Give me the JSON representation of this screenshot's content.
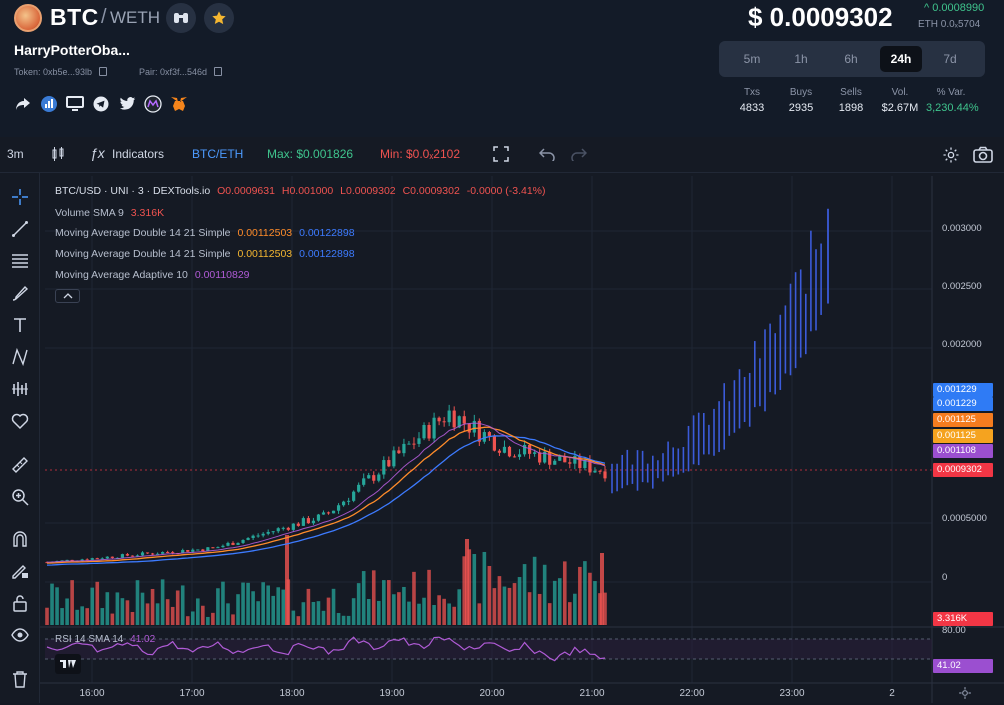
{
  "header": {
    "pair": "BTC",
    "separator": "/",
    "quote": "WETH",
    "token_name": "HarryPotterOba...",
    "token_addr": "Token: 0xb5e...93lb",
    "pair_addr": "Pair: 0xf3f...546d",
    "price": "$ 0.0009302",
    "change": "^ 0.0008990",
    "eth_price": "ETH 0.0ₓ5704",
    "timeframes": [
      "5m",
      "1h",
      "6h",
      "24h",
      "7d"
    ],
    "active_timeframe": "24h",
    "stats": [
      {
        "label": "Txs",
        "value": "4833"
      },
      {
        "label": "Buys",
        "value": "2935"
      },
      {
        "label": "Sells",
        "value": "1898"
      },
      {
        "label": "Vol.",
        "value": "$2.67M"
      },
      {
        "label": "% Var.",
        "value": "3,230.44%"
      }
    ]
  },
  "toolbar": {
    "interval": "3m",
    "indicators": "Indicators",
    "symbol": "BTC/ETH",
    "max": "Max: $0.001826",
    "min": "Min: $0.0ₓ2102"
  },
  "legend": {
    "title": "BTC/USD · UNI · 3 · DEXTools.io",
    "o": "O0.0009631",
    "h": "H0.001000",
    "l": "L0.0009302",
    "c": "C0.0009302",
    "chg": "-0.0000 (-3.41%)",
    "volume_label": "Volume SMA 9",
    "volume_value": "3.316K",
    "ma1_label": "Moving Average Double 14 21 Simple",
    "ma1_v1": "0.00112503",
    "ma1_v2": "0.00122898",
    "ma2_label": "Moving Average Double 14 21 Simple",
    "ma2_v1": "0.00112503",
    "ma2_v2": "0.00122898",
    "ma3_label": "Moving Average Adaptive 10",
    "ma3_v1": "0.00110829",
    "rsi_label": "RSI 14 SMA 14",
    "rsi_value": "41.02"
  },
  "yaxis": {
    "ticks": [
      "0.003000",
      "0.002500",
      "0.002000",
      "0.0005000",
      "0"
    ],
    "tags": [
      "0.001229",
      "0.001229",
      "0.001125",
      "0.001125",
      "0.001108",
      "0.0009302"
    ],
    "volume_tag": "3.316K",
    "rsi_tick": "80.00",
    "rsi_tag": "41.02"
  },
  "xaxis": {
    "ticks": [
      "16:00",
      "17:00",
      "18:00",
      "19:00",
      "20:00",
      "21:00",
      "22:00",
      "23:00",
      "2"
    ]
  },
  "colors": {
    "up": "#26a69a",
    "down": "#ef5350",
    "projection": "#3b5bd9",
    "ma_orange": "#ff8c2a",
    "ma_blue": "#3d7bff",
    "ma_purple": "#b05bd6",
    "price_tag": "#f23645",
    "accent_green": "#3fc48d"
  },
  "chart_data": {
    "type": "candlestick",
    "title": "BTC/USD · UNI · 3 · DEXTools.io",
    "x_ticks": [
      "16:00",
      "17:00",
      "18:00",
      "19:00",
      "20:00",
      "21:00",
      "22:00",
      "23:00",
      "2"
    ],
    "y_ticks": [
      "0.003000",
      "0.002500",
      "0.002000",
      "0.0005000",
      "0"
    ],
    "last_price": 0.0009302,
    "series": [
      {
        "name": "Moving Average Double 14 21 Simple",
        "values_last": [
          0.00112503,
          0.00122898
        ]
      },
      {
        "name": "Moving Average Adaptive 10",
        "values_last": [
          0.00110829
        ]
      },
      {
        "name": "Volume SMA 9",
        "values_last": [
          3316
        ]
      },
      {
        "name": "RSI 14 SMA 14",
        "values_last": [
          41.02
        ]
      }
    ]
  }
}
